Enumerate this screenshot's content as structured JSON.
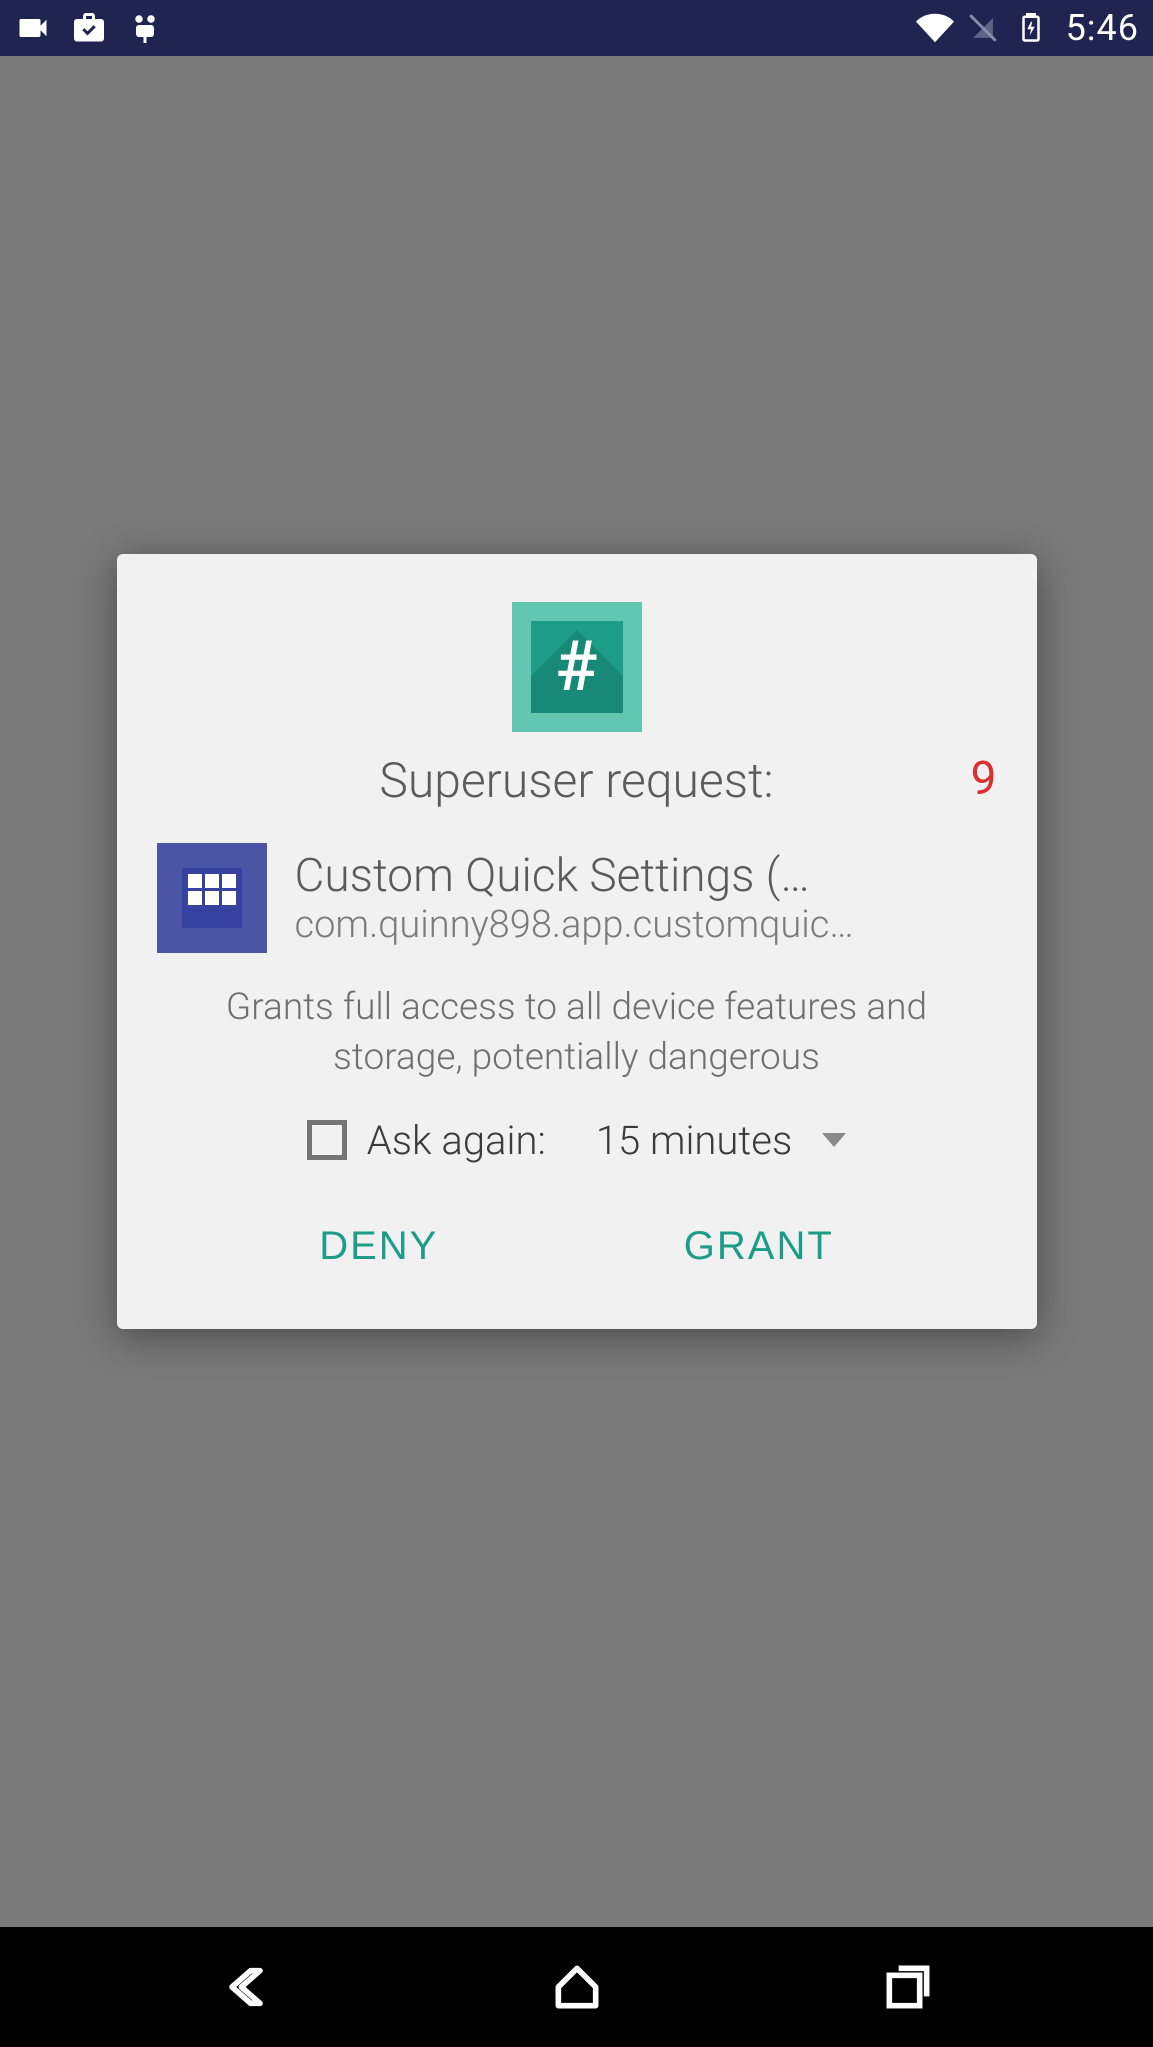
{
  "status_bar": {
    "time": "5:46"
  },
  "dialog": {
    "title": "Superuser request:",
    "countdown": "9",
    "app_name": "Custom Quick Settings (…",
    "app_package": "com.quinny898.app.customquic…",
    "warning": "Grants full access to all device features and storage, potentially dangerous",
    "ask_label": "Ask again:",
    "ask_value": "15 minutes",
    "deny": "DENY",
    "grant": "GRANT"
  }
}
